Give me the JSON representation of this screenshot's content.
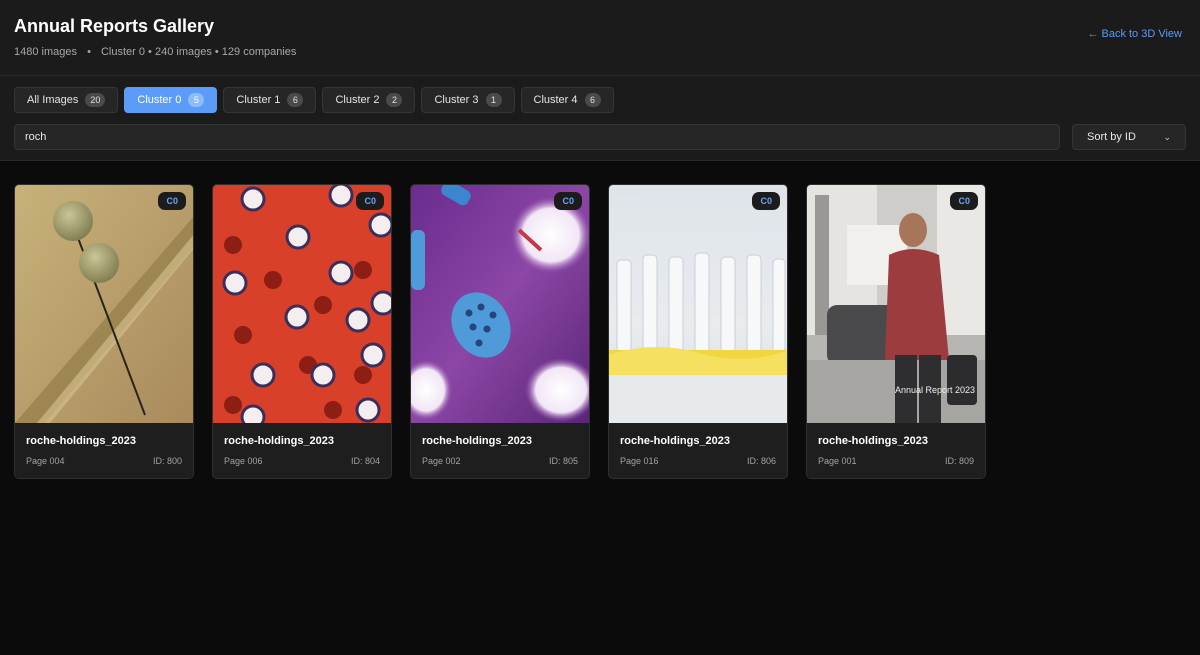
{
  "header": {
    "title": "Annual Reports Gallery",
    "image_count": "1480 images",
    "separator": "•",
    "cluster_summary": "Cluster 0 • 240 images • 129 companies",
    "back_link": "← Back to 3D View"
  },
  "tabs": [
    {
      "label": "All Images",
      "count": "20"
    },
    {
      "label": "Cluster 0",
      "count": "5"
    },
    {
      "label": "Cluster 1",
      "count": "6"
    },
    {
      "label": "Cluster 2",
      "count": "2"
    },
    {
      "label": "Cluster 3",
      "count": "1"
    },
    {
      "label": "Cluster 4",
      "count": "6"
    }
  ],
  "active_tab": "Cluster 0",
  "search": {
    "value": "roch"
  },
  "sort": {
    "label": "Sort by ID"
  },
  "cards": [
    {
      "title": "roche-holdings_2023",
      "page": "Page 004",
      "id": "ID: 800",
      "cluster": "C0"
    },
    {
      "title": "roche-holdings_2023",
      "page": "Page 006",
      "id": "ID: 804",
      "cluster": "C0"
    },
    {
      "title": "roche-holdings_2023",
      "page": "Page 002",
      "id": "ID: 805",
      "cluster": "C0"
    },
    {
      "title": "roche-holdings_2023",
      "page": "Page 016",
      "id": "ID: 806",
      "cluster": "C0"
    },
    {
      "title": "roche-holdings_2023",
      "page": "Page 001",
      "id": "ID: 809",
      "cluster": "C0",
      "thumb_text": "Annual Report 2023"
    }
  ],
  "colors": {
    "accent": "#5a9cf8",
    "background": "#0b0b0b",
    "panel": "#1b1b1b",
    "chip_text": "#6aa6f8"
  }
}
